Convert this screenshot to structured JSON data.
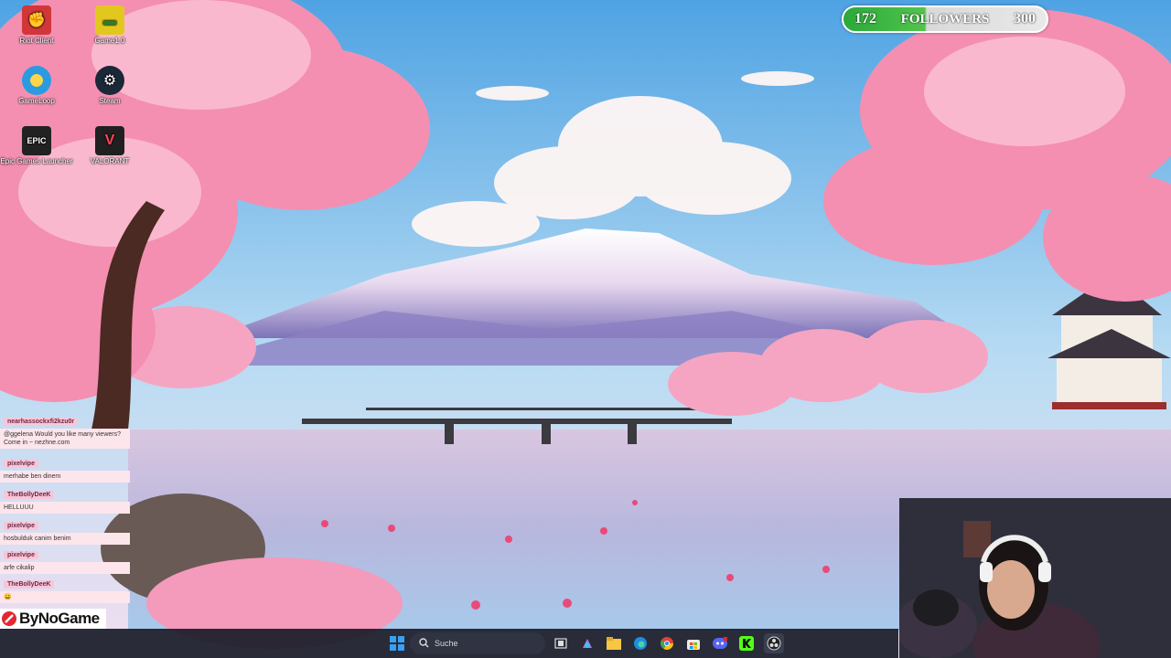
{
  "desktop_icons": [
    {
      "label": "Riot Client",
      "icon": "riot-client-icon",
      "color": "#d13639"
    },
    {
      "label": "Game1.0",
      "icon": "game-folder-icon",
      "color": "#e2c81e"
    },
    {
      "label": "GameLoop",
      "icon": "gameloop-icon",
      "color": "#2a9be0"
    },
    {
      "label": "Steam",
      "icon": "steam-icon",
      "color": "#1b2838"
    },
    {
      "label": "Epic Games Launcher",
      "icon": "epic-games-icon",
      "color": "#222222"
    },
    {
      "label": "VALORANT",
      "icon": "valorant-icon",
      "color": "#202020"
    }
  ],
  "followers_widget": {
    "current": "172",
    "label": "FOLLOWERS",
    "goal": "300",
    "progress": 0.57
  },
  "chat": [
    {
      "user": "nearhassockxfi2kzu0r",
      "text": "@ggelena Would you like many viewers? Come in ~ nezhne.com"
    },
    {
      "user": "pixelvipe",
      "text": "merhabe ben dinem"
    },
    {
      "user": "TheBollyDeeK",
      "text": "HELLUUU"
    },
    {
      "user": "pixelvipe",
      "text": "hosbulduk canim benim"
    },
    {
      "user": "pixelvipe",
      "text": "arfe cikalip"
    },
    {
      "user": "TheBollyDeeK",
      "text": "😀"
    }
  ],
  "brand_overlay": {
    "text": "ByNoGame"
  },
  "taskbar": {
    "search_placeholder": "Suche",
    "items": [
      "windows-start-icon",
      "search-icon",
      "task-view-icon",
      "copilot-icon",
      "file-explorer-icon",
      "edge-icon",
      "chrome-icon",
      "store-icon",
      "discord-icon",
      "kick-icon",
      "obs-icon"
    ]
  },
  "colors": {
    "sky": "#7fb9e6",
    "blossom": "#f59bb6",
    "water": "#c9b4d6",
    "taskbar": "#181c28",
    "followers_green": "#2aa93a"
  }
}
